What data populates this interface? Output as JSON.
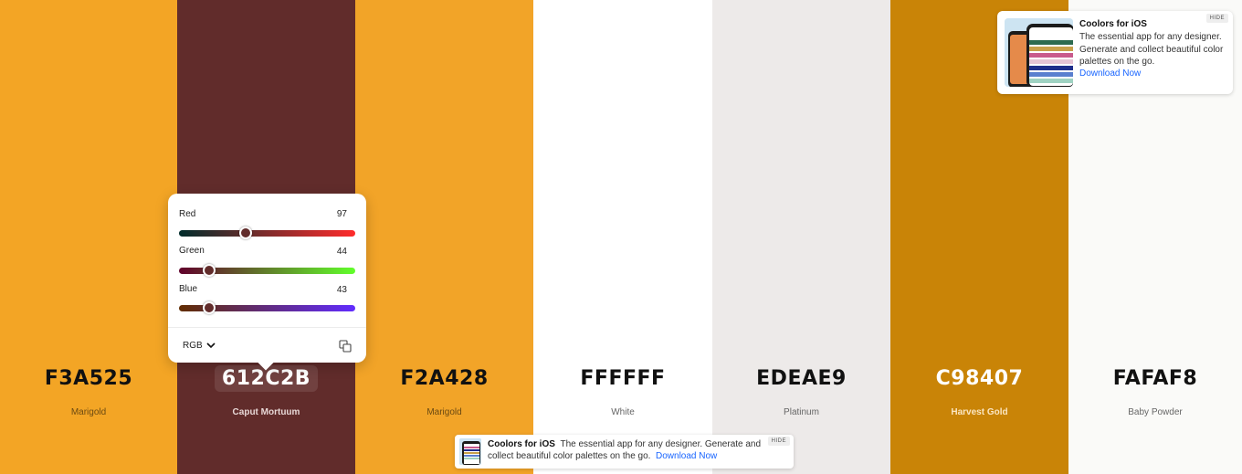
{
  "palette": [
    {
      "hex": "F3A525",
      "name": "Marigold",
      "bg": "#F3A525",
      "text": "#111111",
      "name_color": "#6b4a12",
      "active": false,
      "bold_name": false,
      "width": 194
    },
    {
      "hex": "612C2B",
      "name": "Caput Mortuum",
      "bg": "#612C2B",
      "text": "#ffffff",
      "name_color": "#e8d8d7",
      "active": true,
      "bold_name": true,
      "width": 195
    },
    {
      "hex": "F2A428",
      "name": "Marigold",
      "bg": "#F2A428",
      "text": "#111111",
      "name_color": "#6b4a12",
      "active": false,
      "bold_name": false,
      "width": 195
    },
    {
      "hex": "FFFFFF",
      "name": "White",
      "bg": "#FFFFFF",
      "text": "#111111",
      "name_color": "#666666",
      "active": false,
      "bold_name": false,
      "width": 196
    },
    {
      "hex": "EDEAE9",
      "name": "Platinum",
      "bg": "#EDEAE9",
      "text": "#111111",
      "name_color": "#666666",
      "active": false,
      "bold_name": false,
      "width": 195
    },
    {
      "hex": "C98407",
      "name": "Harvest Gold",
      "bg": "#C98407",
      "text": "#ffffff",
      "name_color": "#fbe6c2",
      "active": false,
      "bold_name": true,
      "width": 195
    },
    {
      "hex": "FAFAF8",
      "name": "Baby Powder",
      "bg": "#FAFAF8",
      "text": "#111111",
      "name_color": "#666666",
      "active": false,
      "bold_name": false,
      "width": 190
    }
  ],
  "picker": {
    "channels": [
      {
        "label": "Red",
        "value": "97",
        "fraction": 0.38,
        "gradient": "linear-gradient(90deg,#002c2b,#ff2c2b)"
      },
      {
        "label": "Green",
        "value": "44",
        "fraction": 0.173,
        "gradient": "linear-gradient(90deg,#61002b,#61ff2b)"
      },
      {
        "label": "Blue",
        "value": "43",
        "fraction": 0.169,
        "gradient": "linear-gradient(90deg,#612c00,#612cff)"
      }
    ],
    "mode": "RGB"
  },
  "ad_top": {
    "title": "Coolors for iOS",
    "description": "The essential app for any designer. Generate and collect beautiful color palettes on the go.",
    "link": "Download Now",
    "hide": "HIDE"
  },
  "ad_bottom": {
    "title": "Coolors for iOS",
    "description": "The essential app for any designer. Generate and collect beautiful color palettes on the go.",
    "link": "Download Now",
    "hide": "HIDE"
  }
}
